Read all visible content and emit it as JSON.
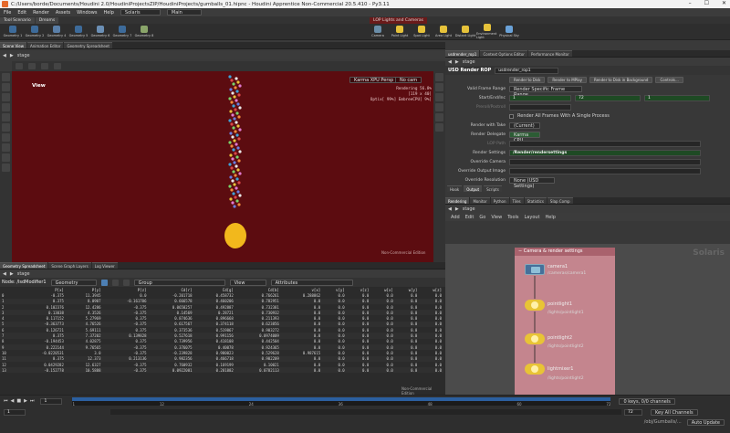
{
  "window": {
    "title": "C:/Users/borde/Documents/Houdini 2.0/HoudiniProjectsZIP/HoudiniProjects/gumballs_01.hipnc - Houdini Apprentice Non-Commercial 20.5.410 - Py3.11"
  },
  "menubar": {
    "items": [
      "File",
      "Edit",
      "Render",
      "Assets",
      "Windows",
      "Help"
    ],
    "desktop": "Solaris",
    "main": "Main"
  },
  "shelf_left": {
    "tabs": [
      "Tool Scenario",
      "Dreams"
    ],
    "tools": [
      "Sphere",
      "Geometry 1",
      "Geometry 2",
      "Null",
      "Geometry 4",
      "Sub",
      "Geometry 5",
      "Soft",
      "Geometry 6",
      "Geometry 7",
      "Light",
      "Geometry 8"
    ]
  },
  "shelf_right": {
    "tabs": [
      "LOP Lights and Cameras"
    ],
    "tools": [
      "Camera",
      "Point Light",
      "Spot Light",
      "Area Light",
      "Distant Light",
      "Dome Light",
      "Environment Light",
      "Background Plate",
      "Portal Light",
      "Physical Sky"
    ]
  },
  "left_tabs": [
    "Scene View",
    "Animation Editor",
    "Geometry Spreadsheet"
  ],
  "left_path": "stage",
  "viewport": {
    "label": "View",
    "renderer": "Karma XPU Persp",
    "cam": "No cam",
    "status_lines": [
      "Rendering 56.8%",
      "[119 x 40]",
      "Optix[ 99%] EmbreeCPU[ 9%]"
    ],
    "edition": "Non-Commercial Edition"
  },
  "spreadsheet": {
    "tabs": [
      "Geometry Spreadsheet",
      "Scene Graph Layers",
      "Log Viewer"
    ],
    "path": "stage",
    "node": "Node: /lsdModifier1",
    "filter1": "Geometry",
    "group": "Group",
    "view": "View",
    "attributes": "Attributes",
    "columns": [
      "",
      "P[x]",
      "P[y]",
      "P[z]",
      "Cd[r]",
      "Cd[g]",
      "Cd[b]",
      "v[x]",
      "v[y]",
      "v[z]",
      "w[x]",
      "w[y]",
      "w[z]"
    ],
    "rows": [
      [
        "0",
        "-0.375",
        "11.3945",
        "0.0",
        "-0.201718",
        "0.458732",
        "0.766261",
        "0.288862",
        "0.0",
        "0.0",
        "0.0",
        "0.0",
        "0.0",
        "0.0"
      ],
      [
        "1",
        "0.375",
        "8.0907",
        "-0.161706",
        "0.666578",
        "0.460206",
        "0.782951",
        "0.0",
        "0.0",
        "0.0",
        "0.0",
        "0.0",
        "0.0"
      ],
      [
        "2",
        "0.102376",
        "12.4286",
        "-0.375",
        "0.0658257",
        "0.492887",
        "0.732381",
        "0.0",
        "0.0",
        "0.0",
        "0.0",
        "0.0",
        "0.0"
      ],
      [
        "3",
        "0.13038",
        "4.3526",
        "-0.375",
        "0.14569",
        "0.28721",
        "0.730932",
        "0.0",
        "0.0",
        "0.0",
        "0.0",
        "0.0",
        "0.0"
      ],
      [
        "4",
        "0.117152",
        "5.27969",
        "0.375",
        "0.874636",
        "0.896668",
        "0.211393",
        "0.0",
        "0.0",
        "0.0",
        "0.0",
        "0.0",
        "0.0"
      ],
      [
        "5",
        "-0.363773",
        "4.76526",
        "-0.375",
        "0.617567",
        "0.374118",
        "0.623856",
        "0.0",
        "0.0",
        "0.0",
        "0.0",
        "0.0",
        "0.0"
      ],
      [
        "6",
        "0.126721",
        "5.69111",
        "0.375",
        "0.373536",
        "0.519867",
        "0.903272",
        "0.0",
        "0.0",
        "0.0",
        "0.0",
        "0.0",
        "0.0"
      ],
      [
        "7",
        "0.375",
        "7.37202",
        "0.139828",
        "0.527618",
        "0.991156",
        "0.0974009",
        "0.0",
        "0.0",
        "0.0",
        "0.0",
        "0.0",
        "0.0"
      ],
      [
        "8",
        "-0.194453",
        "4.02875",
        "0.375",
        "0.739956",
        "0.418108",
        "0.442504",
        "0.0",
        "0.0",
        "0.0",
        "0.0",
        "0.0",
        "0.0"
      ],
      [
        "9",
        "0.222144",
        "9.76565",
        "-0.375",
        "0.376075",
        "0.40078",
        "0.924365",
        "0.0",
        "0.0",
        "0.0",
        "0.0",
        "0.0",
        "0.0"
      ],
      [
        "10",
        "-0.0220531",
        "3.0",
        "-0.375",
        "-0.239828",
        "0.980023",
        "0.529628",
        "0.987615",
        "0.0",
        "0.0",
        "0.0",
        "0.0",
        "0.0"
      ],
      [
        "11",
        "0.375",
        "12.373",
        "0.213136",
        "0.982356",
        "0.466718",
        "0.902209",
        "0.0",
        "0.0",
        "0.0",
        "0.0",
        "0.0",
        "0.0"
      ],
      [
        "12",
        "0.0429282",
        "12.6327",
        "-0.375",
        "0.760932",
        "0.169199",
        "0.10021",
        "0.0",
        "0.0",
        "0.0",
        "0.0",
        "0.0",
        "0.0"
      ],
      [
        "13",
        "-0.152778",
        "10.5888",
        "-0.375",
        "0.0922081",
        "0.281882",
        "0.0782113",
        "0.0",
        "0.0",
        "0.0",
        "0.0",
        "0.0",
        "0.0"
      ]
    ],
    "edition": "Non-Commercial Edition"
  },
  "right_top": {
    "tabs": [
      "usdrender_rop1",
      "Context Options Editor",
      "Performance Monitor"
    ],
    "path": "stage",
    "node_type": "USD Render ROP",
    "node_name": "usdrender_rop1",
    "buttons": [
      "Render to Disk",
      "Render to MPlay",
      "Render to Disk in Background",
      "Controls..."
    ],
    "valid_frame_range_label": "Valid Frame Range",
    "valid_frame_range": "Render Specific Frame Range",
    "start_end_label": "Start/End/Inc",
    "start": "1",
    "end": "72",
    "inc": "1",
    "preroll_label": "Preroll/Postroll",
    "all_frames_label": "Render All Frames With A Single Process",
    "render_take_label": "Render with Take",
    "render_take": "(Current)",
    "delegate_label": "Render Delegate",
    "delegate": "Karma CPU",
    "lop_path_label": "LOP Path",
    "render_settings_label": "Render Settings",
    "render_settings": "/Render/rendersettings",
    "override_camera_label": "Override Camera",
    "override_output_label": "Override Output Image",
    "override_resolution_label": "Override Resolution",
    "override_resolution": "None (USD Settings)",
    "subtabs": [
      "Hook",
      "Output",
      "Scripts"
    ]
  },
  "right_bottom": {
    "tabs": [
      "Rendering",
      "Monitor",
      "Python",
      "Tiles",
      "Statistics",
      "Slap Comp"
    ],
    "path": "stage",
    "menu": [
      "Add",
      "Edit",
      "Go",
      "View",
      "Tools",
      "Layout",
      "Help"
    ],
    "context": "Solaris",
    "netbox_title": "Camera & render settings",
    "nodes": [
      {
        "name": "camera1",
        "path": "/cameras/camera1"
      },
      {
        "name": "pointlight1",
        "path": "/lights/pointlight1"
      },
      {
        "name": "pointlight2",
        "path": "/lights/pointlight2"
      },
      {
        "name": "lightmixer1",
        "path": "/lights/pointlight2"
      }
    ]
  },
  "timeline": {
    "frame": "1",
    "start": "1",
    "end": "72",
    "ticks": [
      "1",
      "12",
      "24",
      "36",
      "48",
      "60",
      "72"
    ],
    "keys": "0 keys, 0/0 channels",
    "key_all": "Key All Channels",
    "auto_update": "Auto Update",
    "scene": "/obj/Gumballs/..."
  },
  "colors": {
    "viewport_bg": "#5c0c10",
    "accent": "#e4692b",
    "node_box": "#c4858e"
  }
}
